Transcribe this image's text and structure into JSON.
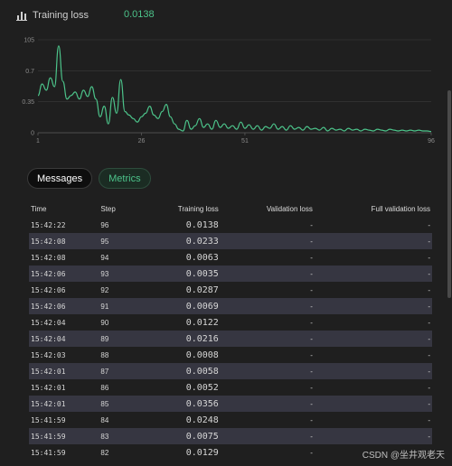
{
  "header": {
    "title": "Training loss",
    "value": "0.0138",
    "icon": "bar-chart-icon"
  },
  "chart_data": {
    "type": "line",
    "title": "",
    "xlabel": "",
    "ylabel": "",
    "xlim": [
      1,
      96
    ],
    "ylim": [
      0,
      1.05
    ],
    "x_ticks": [
      "1",
      "26",
      "51",
      "96"
    ],
    "y_ticks": [
      "105",
      "0.7",
      "0.35",
      "0"
    ],
    "x_tick_values": [
      1,
      26,
      51,
      96
    ],
    "y_tick_values": [
      1.05,
      0.7,
      0.35,
      0
    ],
    "grid": true,
    "color": "#4cc38a",
    "series": [
      {
        "x": [
          1,
          2,
          3,
          4,
          5,
          6,
          7,
          8,
          9,
          10,
          11,
          12,
          13,
          14,
          15,
          16,
          17,
          18,
          19,
          20,
          21,
          22,
          23,
          24,
          25,
          26,
          27,
          28,
          29,
          30,
          31,
          32,
          33,
          34,
          35,
          36,
          37,
          38,
          39,
          40,
          41,
          42,
          43,
          44,
          45,
          46,
          47,
          48,
          49,
          50,
          51,
          52,
          53,
          54,
          55,
          56,
          57,
          58,
          59,
          60,
          61,
          62,
          63,
          64,
          65,
          66,
          67,
          68,
          69,
          70,
          71,
          72,
          73,
          74,
          75,
          76,
          77,
          78,
          79,
          80,
          81,
          82,
          83,
          84,
          85,
          86,
          87,
          88,
          89,
          90,
          91,
          92,
          93,
          94,
          95,
          96
        ],
        "values": [
          0.42,
          0.55,
          0.48,
          0.62,
          0.52,
          0.98,
          0.58,
          0.38,
          0.42,
          0.46,
          0.38,
          0.48,
          0.41,
          0.52,
          0.38,
          0.18,
          0.3,
          0.1,
          0.4,
          0.22,
          0.6,
          0.24,
          0.2,
          0.16,
          0.12,
          0.18,
          0.22,
          0.3,
          0.2,
          0.16,
          0.24,
          0.32,
          0.18,
          0.1,
          0.04,
          0.02,
          0.14,
          0.04,
          0.08,
          0.16,
          0.06,
          0.1,
          0.04,
          0.14,
          0.06,
          0.1,
          0.05,
          0.08,
          0.04,
          0.12,
          0.05,
          0.09,
          0.04,
          0.08,
          0.03,
          0.07,
          0.05,
          0.1,
          0.04,
          0.07,
          0.03,
          0.08,
          0.04,
          0.06,
          0.03,
          0.07,
          0.04,
          0.05,
          0.03,
          0.06,
          0.02,
          0.05,
          0.03,
          0.04,
          0.02,
          0.05,
          0.03,
          0.04,
          0.02,
          0.04,
          0.03,
          0.02,
          0.04,
          0.03,
          0.02,
          0.04,
          0.03,
          0.02,
          0.03,
          0.02,
          0.03,
          0.02,
          0.03,
          0.02,
          0.02,
          0.0138
        ]
      }
    ]
  },
  "tabs": {
    "messages": "Messages",
    "metrics": "Metrics"
  },
  "table": {
    "headers": [
      "Time",
      "Step",
      "Training loss",
      "Validation loss",
      "Full validation loss"
    ],
    "rows": [
      [
        "15:42:22",
        "96",
        "0.0138",
        "-",
        "-"
      ],
      [
        "15:42:08",
        "95",
        "0.0233",
        "-",
        "-"
      ],
      [
        "15:42:08",
        "94",
        "0.0063",
        "-",
        "-"
      ],
      [
        "15:42:06",
        "93",
        "0.0035",
        "-",
        "-"
      ],
      [
        "15:42:06",
        "92",
        "0.0287",
        "-",
        "-"
      ],
      [
        "15:42:06",
        "91",
        "0.0069",
        "-",
        "-"
      ],
      [
        "15:42:04",
        "90",
        "0.0122",
        "-",
        "-"
      ],
      [
        "15:42:04",
        "89",
        "0.0216",
        "-",
        "-"
      ],
      [
        "15:42:03",
        "88",
        "0.0008",
        "-",
        "-"
      ],
      [
        "15:42:01",
        "87",
        "0.0058",
        "-",
        "-"
      ],
      [
        "15:42:01",
        "86",
        "0.0052",
        "-",
        "-"
      ],
      [
        "15:42:01",
        "85",
        "0.0356",
        "-",
        "-"
      ],
      [
        "15:41:59",
        "84",
        "0.0248",
        "-",
        "-"
      ],
      [
        "15:41:59",
        "83",
        "0.0075",
        "-",
        "-"
      ],
      [
        "15:41:59",
        "82",
        "0.0129",
        "-",
        "-"
      ]
    ]
  },
  "watermark": "CSDN @坐井观老天"
}
